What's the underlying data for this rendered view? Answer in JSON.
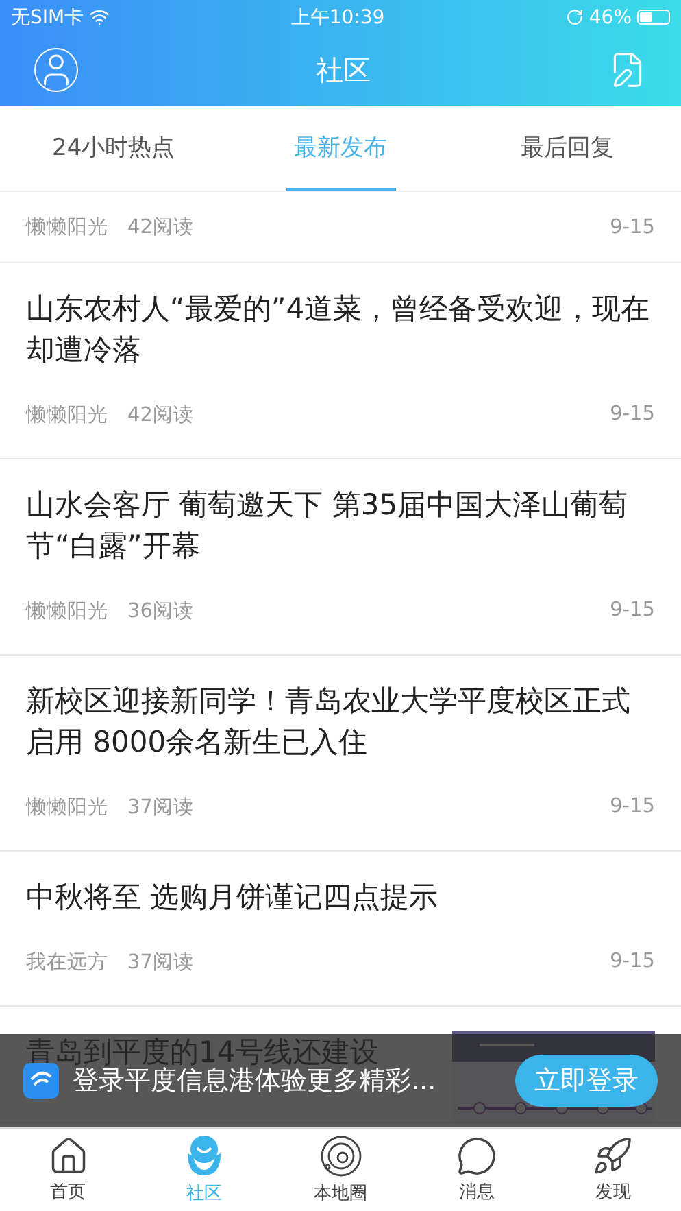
{
  "status_bar": {
    "carrier": "无SIM卡",
    "time": "上午10:39",
    "battery": "46%"
  },
  "header": {
    "title": "社区"
  },
  "tabs": [
    {
      "label": "24小时热点",
      "selected": false
    },
    {
      "label": "最新发布",
      "selected": true
    },
    {
      "label": "最后回复",
      "selected": false
    }
  ],
  "posts": [
    {
      "author": "懒懒阳光",
      "reads": "42阅读",
      "date": "9-15"
    },
    {
      "title": "山东农村人“最爱的”4道菜，曾经备受欢迎，现在却遭冷落",
      "author": "懒懒阳光",
      "reads": "42阅读",
      "date": "9-15"
    },
    {
      "title": "山水会客厅 葡萄邀天下 第35届中国大泽山葡萄节“白露”开幕",
      "author": "懒懒阳光",
      "reads": "36阅读",
      "date": "9-15"
    },
    {
      "title": "新校区迎接新同学！青岛农业大学平度校区正式启用 8000余名新生已入住",
      "author": "懒懒阳光",
      "reads": "37阅读",
      "date": "9-15"
    },
    {
      "title": "中秋将至 选购月饼谨记四点提示",
      "author": "我在远方",
      "reads": "37阅读",
      "date": "9-15"
    },
    {
      "title": "青岛到平度的14号线还建设"
    }
  ],
  "login_banner": {
    "text": "登录平度信息港体验更多精彩...",
    "button": "立即登录"
  },
  "bottom_nav": [
    {
      "label": "首页",
      "kind": "home",
      "selected": false
    },
    {
      "label": "社区",
      "kind": "community",
      "selected": true
    },
    {
      "label": "本地圈",
      "kind": "orbit",
      "selected": false
    },
    {
      "label": "消息",
      "kind": "message",
      "selected": false
    },
    {
      "label": "发现",
      "kind": "rocket",
      "selected": false
    }
  ]
}
